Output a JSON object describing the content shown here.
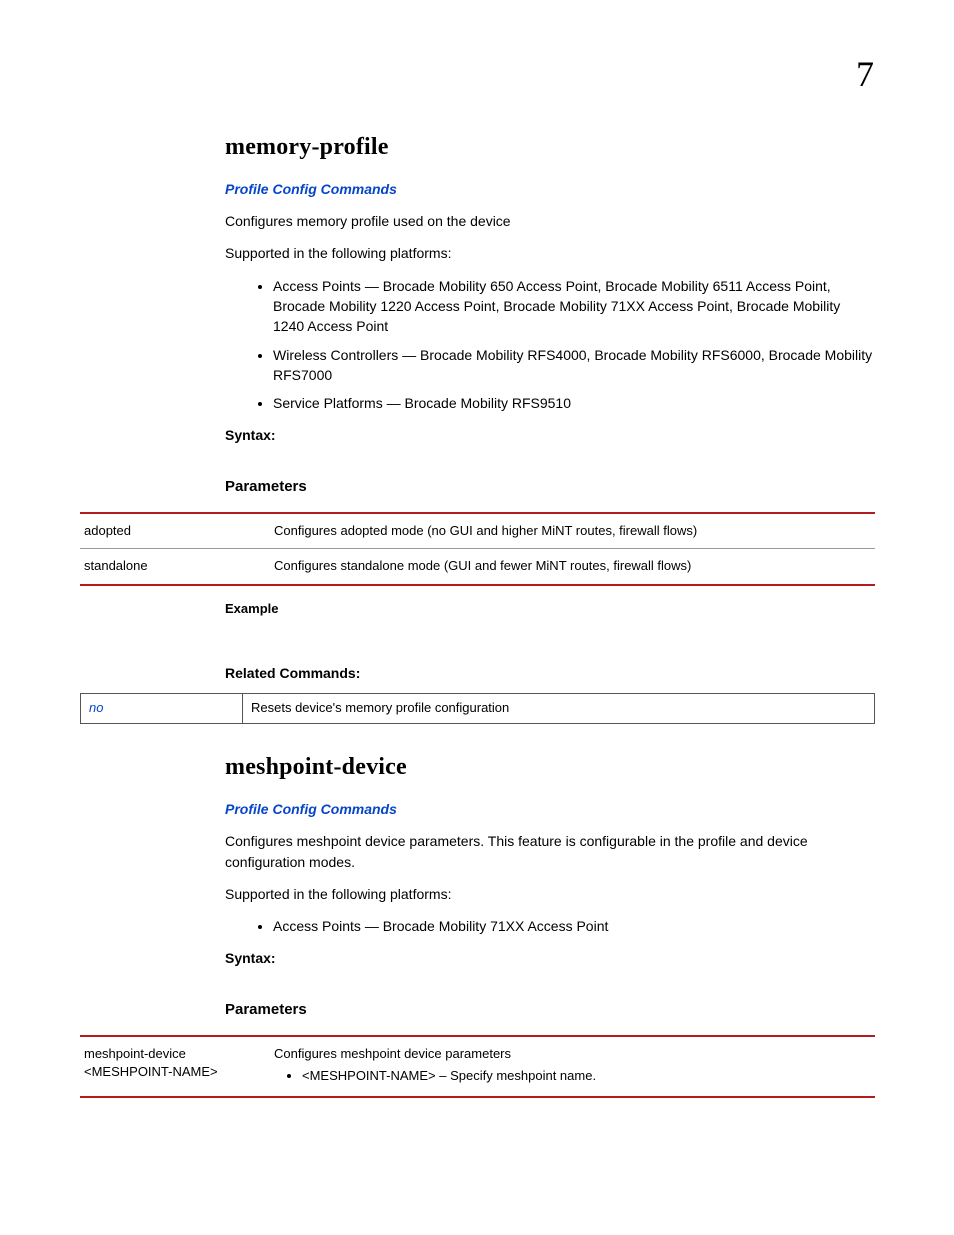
{
  "chapter_number": "7",
  "sections": [
    {
      "title": "memory-profile",
      "link": "Profile Config Commands",
      "desc": "Configures memory profile used on the device",
      "supported_intro": "Supported in the following platforms:",
      "platforms": [
        "Access Points — Brocade Mobility 650 Access Point, Brocade Mobility 6511 Access Point, Brocade Mobility 1220 Access Point, Brocade Mobility 71XX Access Point, Brocade Mobility 1240 Access Point",
        "Wireless Controllers — Brocade Mobility RFS4000, Brocade Mobility RFS6000, Brocade Mobility RFS7000",
        "Service Platforms — Brocade Mobility RFS9510"
      ],
      "syntax_label": "Syntax:",
      "parameters_label": "Parameters",
      "param_rows": [
        {
          "k": "adopted",
          "v": "Configures adopted mode (no GUI and higher MiNT routes, firewall flows)"
        },
        {
          "k": "standalone",
          "v": "Configures standalone mode (GUI and fewer MiNT routes, firewall flows)"
        }
      ],
      "example_label": "Example",
      "related_label": "Related Commands:",
      "related_rows": [
        {
          "k": "no",
          "v": "Resets device's memory profile configuration"
        }
      ]
    },
    {
      "title": "meshpoint-device",
      "link": "Profile Config Commands",
      "desc": "Configures meshpoint device parameters. This feature is configurable in the profile and device configuration modes.",
      "supported_intro": "Supported in the following platforms:",
      "platforms": [
        "Access Points — Brocade Mobility 71XX Access Point"
      ],
      "syntax_label": "Syntax:",
      "parameters_label": "Parameters",
      "param_rows": [
        {
          "k": "meshpoint-device <MESHPOINT-NAME>",
          "v": "Configures meshpoint device parameters",
          "sub": [
            "<MESHPOINT-NAME> – Specify meshpoint name."
          ]
        }
      ]
    }
  ]
}
